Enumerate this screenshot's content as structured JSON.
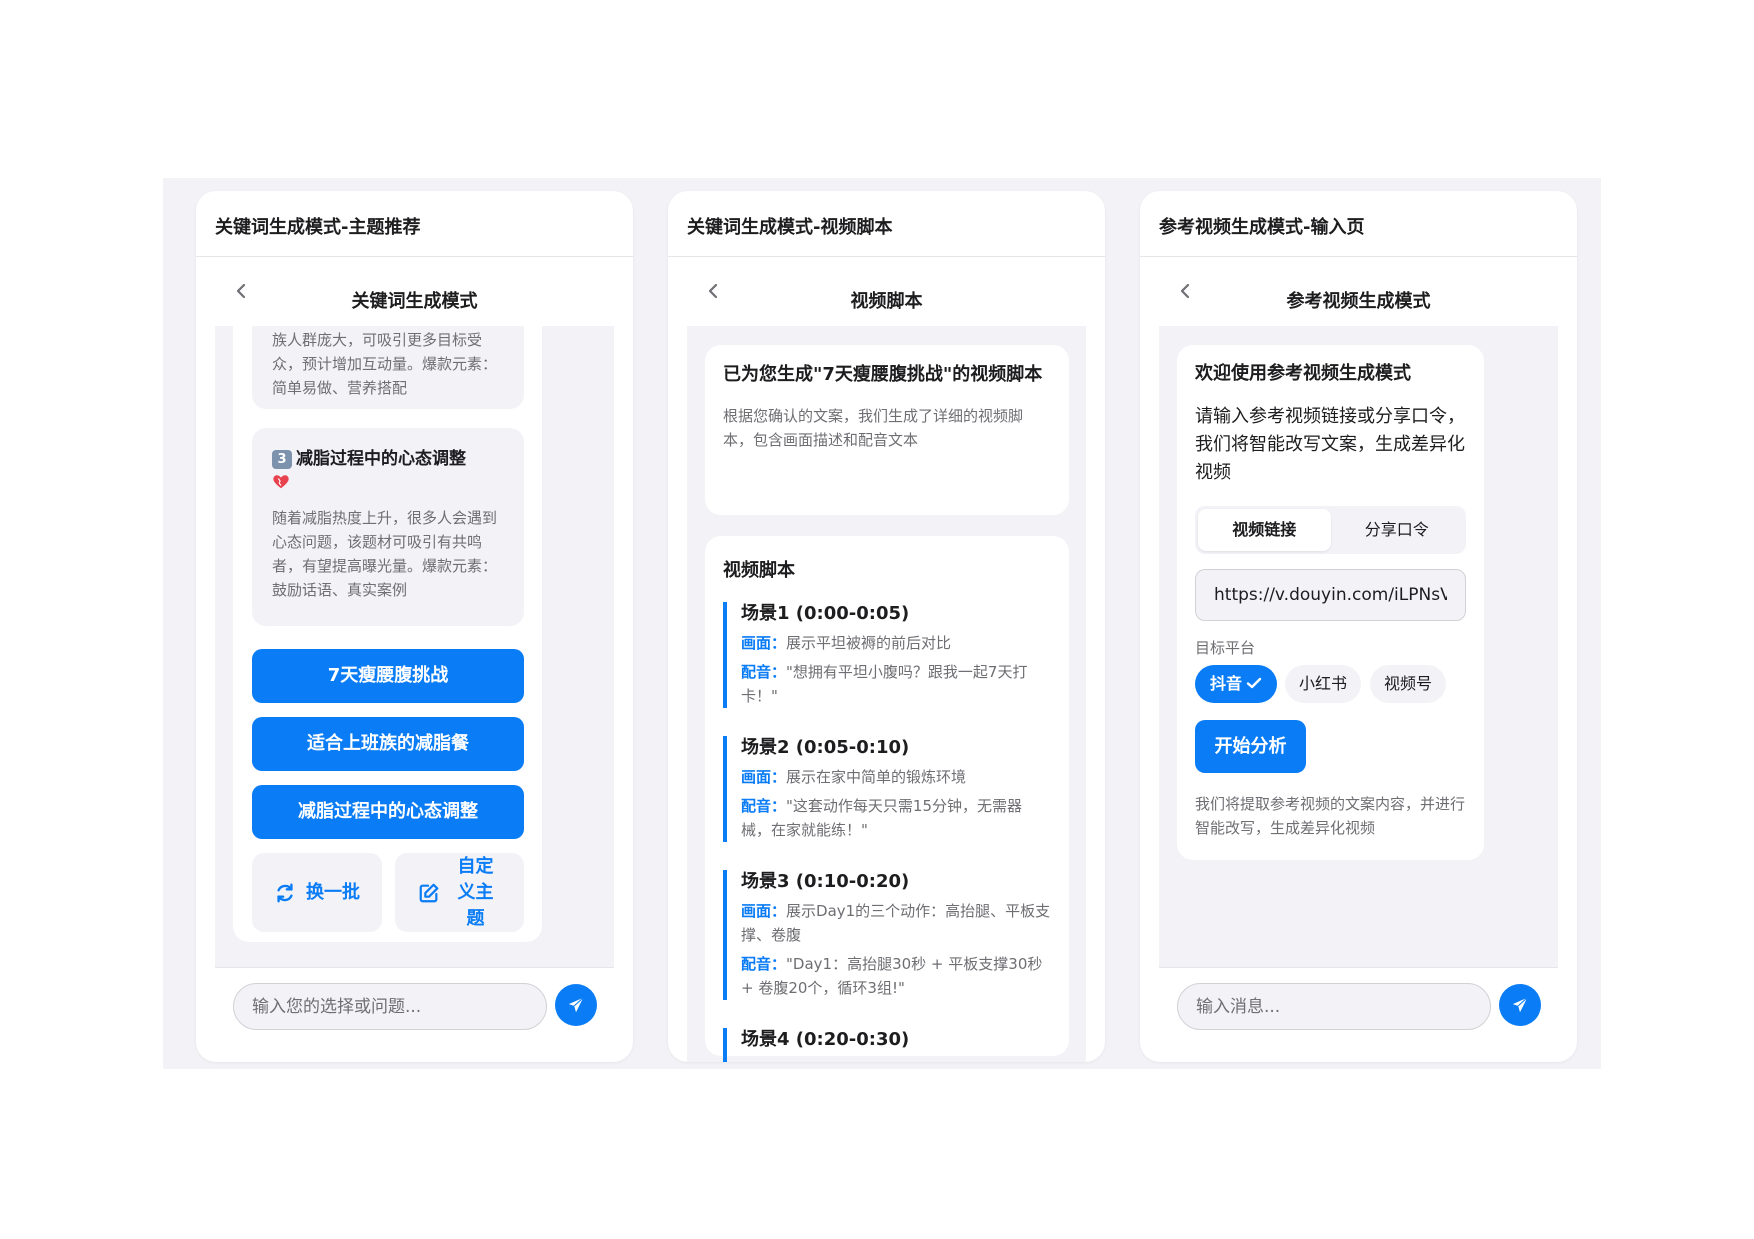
{
  "panels": [
    {
      "title": "关键词生成模式-主题推荐",
      "nav_title": "关键词生成模式",
      "partial_topic_desc": "族人群庞大，可吸引更多目标受众，预计增加互动量。爆款元素：简单易做、营养搭配",
      "topic3": {
        "badge": "3",
        "title": "减脂过程中的心态调整",
        "icon": "heart-icon",
        "desc": "随着减脂热度上升，很多人会遇到心态问题，该题材可吸引有共鸣者，有望提高曝光量。爆款元素：鼓励话语、真实案例"
      },
      "options": [
        "7天瘦腰腹挑战",
        "适合上班族的减脂餐",
        "减脂过程中的心态调整"
      ],
      "refresh_label": "换一批",
      "custom_label": "自定义主题",
      "input_placeholder": "输入您的选择或问题..."
    },
    {
      "title": "关键词生成模式-视频脚本",
      "nav_title": "视频脚本",
      "message_title": "已为您生成\"7天瘦腰腹挑战\"的视频脚本",
      "message_desc": "根据您确认的文案，我们生成了详细的视频脚本，包含画面描述和配音文本",
      "script_heading": "视频脚本",
      "visual_key": "画面：",
      "voice_key": "配音：",
      "scenes": [
        {
          "title": "场景1 (0:00-0:05)",
          "visual": "展示平坦被褥的前后对比",
          "voice": "\"想拥有平坦小腹吗？跟我一起7天打卡！\""
        },
        {
          "title": "场景2 (0:05-0:10)",
          "visual": "展示在家中简单的锻炼环境",
          "voice": "\"这套动作每天只需15分钟，无需器械，在家就能练！\""
        },
        {
          "title": "场景3 (0:10-0:20)",
          "visual": "展示Day1的三个动作：高抬腿、平板支撑、卷腹",
          "voice": "\"Day1：高抬腿30秒 + 平板支撑30秒 + 卷腹20个，循环3组!\""
        },
        {
          "title": "场景4 (0:20-0:30)"
        }
      ]
    },
    {
      "title": "参考视频生成模式-输入页",
      "nav_title": "参考视频生成模式",
      "welcome_title": "欢迎使用参考视频生成模式",
      "welcome_text": "请输入参考视频链接或分享口令，我们将智能改写文案，生成差异化视频",
      "tabs": [
        "视频链接",
        "分享口令"
      ],
      "url_value": "https://v.douyin.com/iLPNsV",
      "platform_label": "目标平台",
      "platforms": [
        "抖音",
        "小红书",
        "视频号"
      ],
      "start_label": "开始分析",
      "footnote": "我们将提取参考视频的文案内容，并进行智能改写，生成差异化视频",
      "input_placeholder": "输入消息..."
    }
  ],
  "colors": {
    "accent": "#0a7cf5",
    "background": "#f2f2f7"
  }
}
